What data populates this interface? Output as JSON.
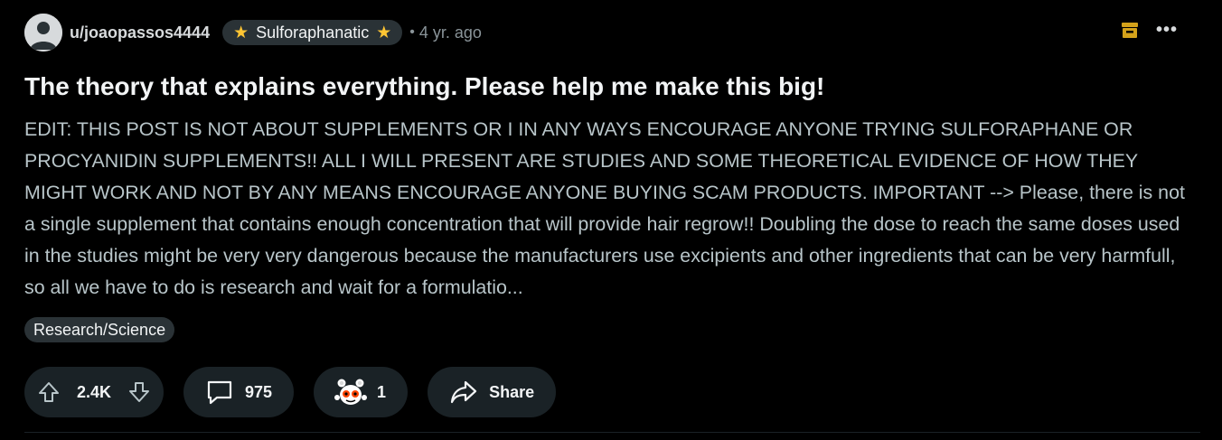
{
  "post": {
    "author": "u/joaopassos4444",
    "user_flair": "Sulforaphanatic",
    "separator": "•",
    "age": "4 yr. ago",
    "title": "The theory that explains everything. Please help me make this big!",
    "body": "EDIT: THIS POST IS NOT ABOUT SUPPLEMENTS OR I IN ANY WAYS ENCOURAGE ANYONE TRYING SULFORAPHANE OR PROCYANIDIN SUPPLEMENTS!! ALL I WILL PRESENT ARE STUDIES AND SOME THEORETICAL EVIDENCE OF HOW THEY MIGHT WORK AND NOT BY ANY MEANS ENCOURAGE ANYONE BUYING SCAM PRODUCTS. IMPORTANT --> Please, there is not a single supplement that contains enough concentration that will provide hair regrow!! Doubling the dose to reach the same doses used in the studies might be very very dangerous because the manufacturers use excipients and other ingredients that can be very harmfull, so all we have to do is research and wait for a formulatio...",
    "post_flair": "Research/Science"
  },
  "actions": {
    "upvotes": "2.4K",
    "comments": "975",
    "awards": "1",
    "share_label": "Share"
  },
  "icons": {
    "avatar": "default-avatar-icon",
    "flair_star": "star-icon",
    "archive": "archive-icon",
    "more": "more-options-icon",
    "upvote": "upvote-arrow-icon",
    "downvote": "downvote-arrow-icon",
    "comment": "comment-bubble-icon",
    "award": "award-icon",
    "share": "share-arrow-icon"
  },
  "colors": {
    "background": "#000000",
    "pill_background": "#1a2226",
    "flair_background": "#2a3236",
    "star": "#ffc533",
    "archive": "#d4a21a",
    "body_text": "#b8c5c9",
    "muted_text": "#8a9499"
  }
}
